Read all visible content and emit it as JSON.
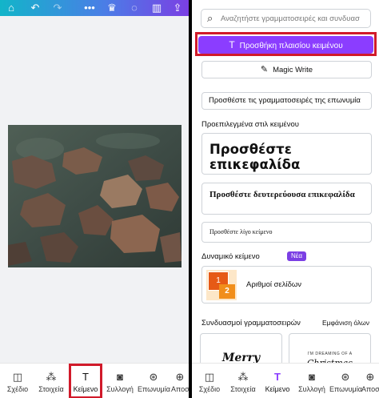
{
  "left": {
    "toolbar": {
      "home_icon": "home-icon",
      "undo_icon": "undo-icon",
      "redo_icon": "redo-icon",
      "more_icon": "more-icon",
      "crown_icon": "crown-icon",
      "comment_icon": "comment-icon",
      "chart_icon": "chart-icon",
      "share_icon": "share-icon"
    },
    "nav": [
      {
        "label": "Σχέδιο",
        "icon": "design-icon"
      },
      {
        "label": "Στοιχεία",
        "icon": "elements-icon"
      },
      {
        "label": "Κείμενο",
        "icon": "text-icon"
      },
      {
        "label": "Συλλογή",
        "icon": "camera-icon"
      },
      {
        "label": "Επωνυμία",
        "icon": "brand-icon"
      },
      {
        "label": "Αποσ",
        "icon": "apps-icon"
      }
    ]
  },
  "right": {
    "search": {
      "placeholder": "Αναζητήστε γραμματοσειρές και συνδυασ"
    },
    "add_textbox_label": "Προσθήκη πλαισίου κειμένου",
    "magic_write_label": "Magic Write",
    "brand_fonts_label": "Προσθέστε τις γραμματοσειρές της επωνυμία",
    "default_styles_title": "Προεπιλεγμένα στιλ κειμένου",
    "heading_card": "Προσθέστε επικεφαλίδα",
    "subheading_card": "Προσθέστε δευτερεύουσα επικεφαλίδα",
    "body_card": "Προσθέστε λίγο κείμενο",
    "dynamic_title": "Δυναμικό κείμενο",
    "new_badge": "Νέα",
    "page_numbers_label": "Αριθμοί σελίδων",
    "page_numbers_thumb": [
      "1",
      "2"
    ],
    "combos_title": "Συνδυασμοί γραμματοσειρών",
    "show_all_label": "Εμφάνιση όλων",
    "combo_cards": [
      {
        "text": "Merry"
      },
      {
        "small": "I'M DREAMING OF A",
        "text": "Christmas"
      }
    ],
    "nav": [
      {
        "label": "Σχέδιο",
        "icon": "design-icon"
      },
      {
        "label": "Στοιχεία",
        "icon": "elements-icon"
      },
      {
        "label": "Κείμενο",
        "icon": "text-icon"
      },
      {
        "label": "Συλλογή",
        "icon": "camera-icon"
      },
      {
        "label": "Επωνυμία",
        "icon": "brand-icon"
      },
      {
        "label": "Αποστ",
        "icon": "apps-icon"
      }
    ]
  },
  "colors": {
    "accent": "#8b3dff",
    "highlight": "#d11a2a"
  }
}
